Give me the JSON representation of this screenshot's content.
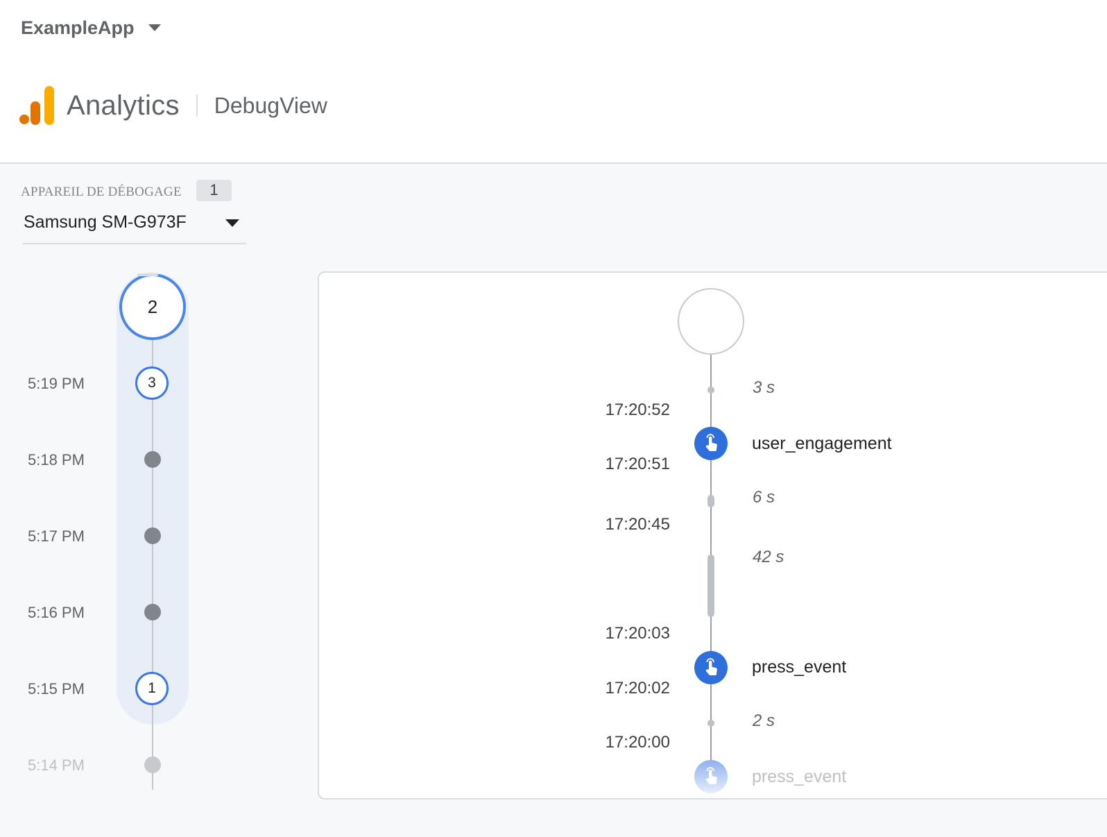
{
  "header": {
    "app_name": "ExampleApp",
    "product": "Analytics",
    "section": "DebugView"
  },
  "device": {
    "label": "APPAREIL DE DÉBOGAGE",
    "count": "1",
    "selected": "Samsung SM-G973F"
  },
  "minutes": {
    "top_count": "2",
    "rows": [
      {
        "time": "5:19 PM",
        "count": "3"
      },
      {
        "time": "5:18 PM"
      },
      {
        "time": "5:17 PM"
      },
      {
        "time": "5:16 PM"
      },
      {
        "time": "5:15 PM",
        "count": "1"
      },
      {
        "time": "5:14 PM"
      }
    ]
  },
  "stream": {
    "durations": [
      "3 s",
      "6 s",
      "42 s",
      "2 s"
    ],
    "timestamps": [
      "17:20:52",
      "17:20:51",
      "17:20:45",
      "17:20:03",
      "17:20:02",
      "17:20:00"
    ],
    "events": [
      "user_engagement",
      "press_event",
      "press_event"
    ]
  },
  "colors": {
    "accent_blue": "#2f6fdc",
    "ring_blue": "#4a86e8",
    "minutes_band": "#e8eef8",
    "logo_orange_dark": "#e37400",
    "logo_orange_light": "#f9ab00"
  },
  "icons": {
    "event": "touch-hand-icon",
    "logo": "analytics-bars-icon",
    "dropdown": "caret-down-icon"
  }
}
